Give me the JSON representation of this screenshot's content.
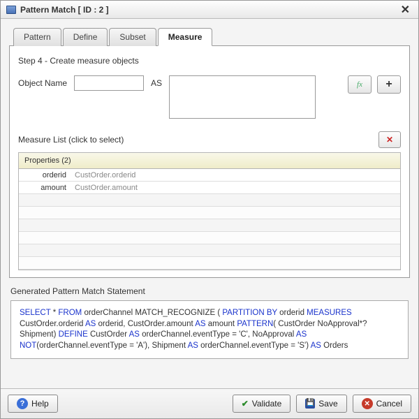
{
  "window": {
    "title": "Pattern Match [ ID : 2 ]"
  },
  "tabs": [
    {
      "label": "Pattern",
      "active": false
    },
    {
      "label": "Define",
      "active": false
    },
    {
      "label": "Subset",
      "active": false
    },
    {
      "label": "Measure",
      "active": true
    }
  ],
  "step_label": "Step 4 - Create measure objects",
  "form": {
    "object_name_label": "Object Name",
    "object_name_value": "",
    "as_label": "AS",
    "as_value": ""
  },
  "measure_list": {
    "header": "Measure List (click to select)",
    "table_header": "Properties (2)",
    "rows": [
      {
        "name": "orderid",
        "value": "CustOrder.orderid"
      },
      {
        "name": "amount",
        "value": "CustOrder.amount"
      }
    ]
  },
  "generated": {
    "label": "Generated Pattern Match Statement",
    "tokens": [
      {
        "t": "SELECT",
        "k": true
      },
      {
        "t": " * "
      },
      {
        "t": "FROM",
        "k": true
      },
      {
        "t": " orderChannel  MATCH_RECOGNIZE ( "
      },
      {
        "t": "PARTITION BY",
        "k": true
      },
      {
        "t": " orderid "
      },
      {
        "t": "MEASURES",
        "k": true
      },
      {
        "t": " CustOrder.orderid "
      },
      {
        "t": "AS",
        "k": true
      },
      {
        "t": " orderid, CustOrder.amount "
      },
      {
        "t": "AS",
        "k": true
      },
      {
        "t": " amount "
      },
      {
        "t": "PATTERN",
        "k": true
      },
      {
        "t": "( CustOrder NoApproval*? Shipment) "
      },
      {
        "t": "DEFINE",
        "k": true
      },
      {
        "t": " CustOrder "
      },
      {
        "t": "AS",
        "k": true
      },
      {
        "t": " orderChannel.eventType = 'C', NoApproval "
      },
      {
        "t": "AS",
        "k": true
      },
      {
        "t": " "
      },
      {
        "t": "NOT",
        "k": true
      },
      {
        "t": "(orderChannel.eventType = 'A'), Shipment "
      },
      {
        "t": "AS",
        "k": true
      },
      {
        "t": " orderChannel.eventType = 'S') "
      },
      {
        "t": "AS",
        "k": true
      },
      {
        "t": " Orders"
      }
    ]
  },
  "footer": {
    "help": "Help",
    "validate": "Validate",
    "save": "Save",
    "cancel": "Cancel"
  }
}
